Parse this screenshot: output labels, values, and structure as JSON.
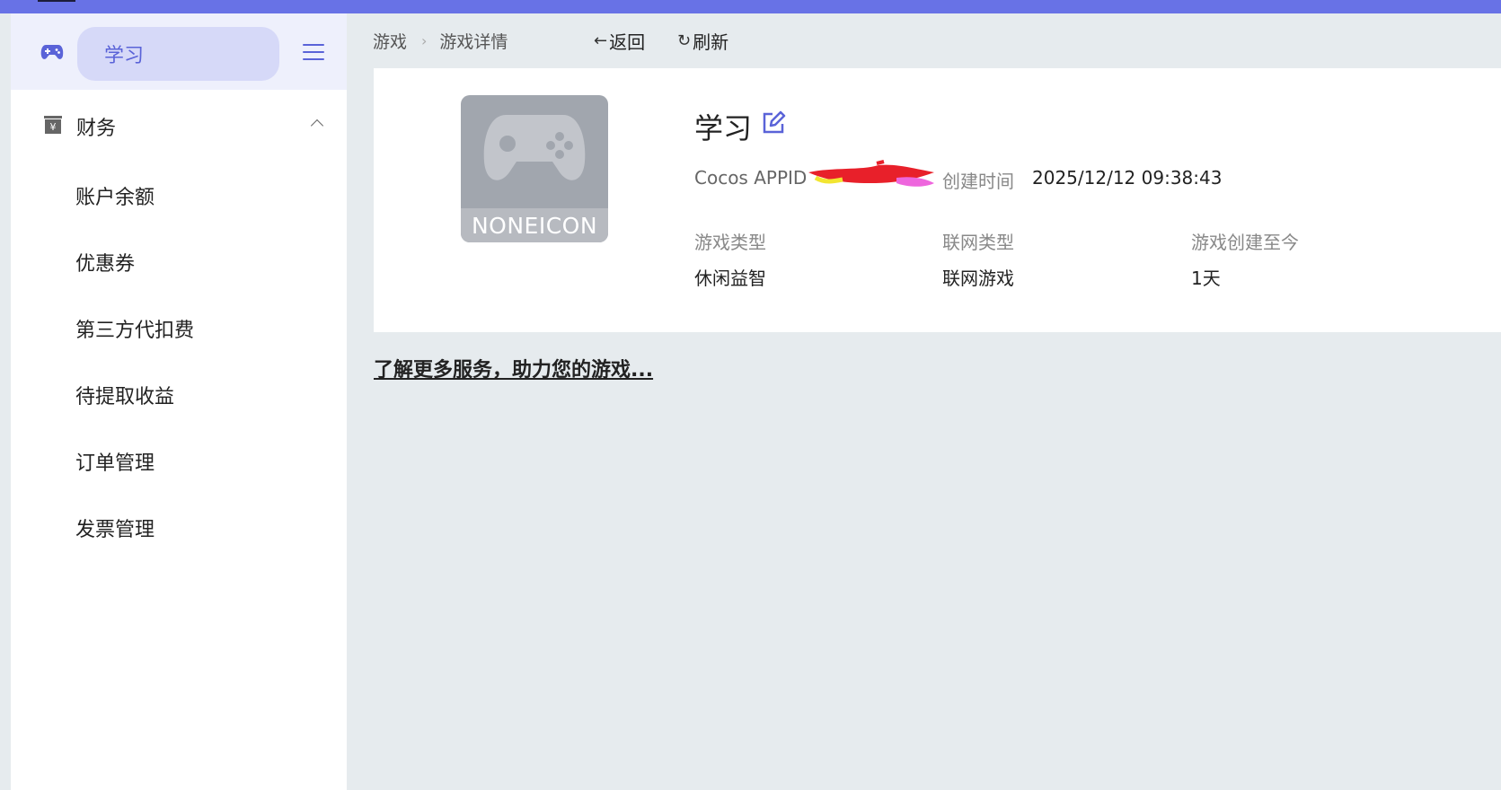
{
  "sidebar": {
    "project_name": "学习",
    "section": {
      "label": "财务"
    },
    "items": [
      {
        "label": "账户余额"
      },
      {
        "label": "优惠券"
      },
      {
        "label": "第三方代扣费"
      },
      {
        "label": "待提取收益"
      },
      {
        "label": "订单管理"
      },
      {
        "label": "发票管理"
      }
    ]
  },
  "breadcrumb": {
    "root": "游戏",
    "current": "游戏详情"
  },
  "actions": {
    "back": "返回",
    "refresh": "刷新"
  },
  "game": {
    "icon_text": "NONEICON",
    "title": "学习",
    "appid_label": "Cocos APPID",
    "created_label": "创建时间",
    "created_value": "2025/12/12 09:38:43",
    "meta": {
      "type_label": "游戏类型",
      "type_value": "休闲益智",
      "network_label": "联网类型",
      "network_value": "联网游戏",
      "age_label": "游戏创建至今",
      "age_value": "1天"
    }
  },
  "more_link": "了解更多服务，助力您的游戏...",
  "colors": {
    "accent": "#5a63d8",
    "topbar": "#6872e6",
    "pill": "#d6d9f8",
    "background": "#e6ebee"
  }
}
